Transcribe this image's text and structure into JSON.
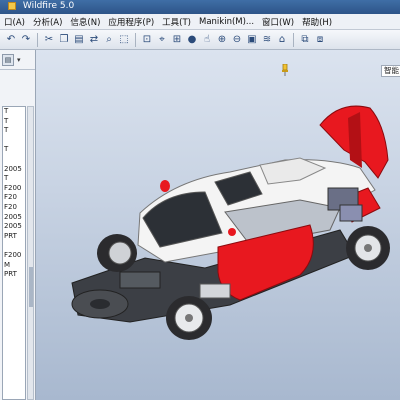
{
  "window": {
    "title": "Wildfire 5.0"
  },
  "menu": [
    {
      "label": "口(A)"
    },
    {
      "label": "分析(A)"
    },
    {
      "label": "信息(N)"
    },
    {
      "label": "应用程序(P)"
    },
    {
      "label": "工具(T)"
    },
    {
      "label": "Manikin(M)..."
    },
    {
      "label": "窗口(W)"
    },
    {
      "label": "帮助(H)"
    }
  ],
  "toolbar": {
    "icons": [
      "undo-icon",
      "redo-icon",
      "cut-icon",
      "copy-icon",
      "paste-icon",
      "regenerate-icon",
      "find-icon",
      "select-icon",
      "refit-icon",
      "datum-icon",
      "orient-icon",
      "shading-icon",
      "spin-icon",
      "zoom-in-icon",
      "zoom-out-icon",
      "view-manager-icon",
      "layer-icon",
      "saved-views-icon",
      "window-icon"
    ]
  },
  "search": {
    "value": "智能"
  },
  "model_tree": {
    "items": [
      {
        "label": "T"
      },
      {
        "label": "T"
      },
      {
        "label": "T"
      },
      {
        "label": ""
      },
      {
        "label": "T"
      },
      {
        "label": ""
      },
      {
        "label": "2005"
      },
      {
        "label": "T"
      },
      {
        "label": "F200"
      },
      {
        "label": "F20"
      },
      {
        "label": "F20"
      },
      {
        "label": "2005"
      },
      {
        "label": "2005"
      },
      {
        "label": "PRT"
      },
      {
        "label": ""
      },
      {
        "label": "F200"
      },
      {
        "label": "M"
      },
      {
        "label": "PRT"
      }
    ]
  },
  "colors": {
    "body_red": "#e8181f",
    "body_white": "#f4f4f4",
    "chassis": "#3c3f45",
    "viewport_top": "#dbe3ef",
    "viewport_bottom": "#a8b8cf"
  }
}
